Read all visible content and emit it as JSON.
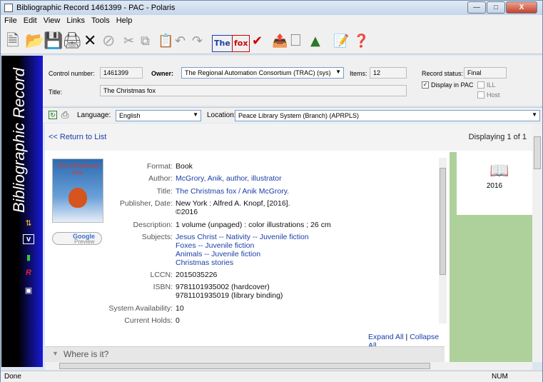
{
  "window": {
    "title": "Bibliographic Record 1461399 - PAC - Polaris"
  },
  "menu": [
    "File",
    "Edit",
    "View",
    "Links",
    "Tools",
    "Help"
  ],
  "toolbar": {
    "icons": [
      "new-icon",
      "open-icon",
      "save-icon",
      "print-icon",
      "delete-icon",
      "cancel-icon",
      "cut-icon",
      "copy-icon",
      "paste-icon",
      "undo-icon",
      "redo-icon",
      "the-icon",
      "fox-icon",
      "spell-icon",
      "export-icon",
      "template-icon",
      "link-icon",
      "properties-icon",
      "help-icon"
    ]
  },
  "sidebar": {
    "title": "Bibliographic Record"
  },
  "header": {
    "control_number_label": "Control number:",
    "control_number": "1461399",
    "owner_label": "Owner:",
    "owner": "The Regional Automation Consortium (TRAC) (sys)",
    "items_label": "Items:",
    "items": "12",
    "record_status_label": "Record status:",
    "record_status": "Final",
    "title_label": "Title:",
    "title": "The Christmas fox",
    "display_in_pac": "Display in PAC",
    "ill": "ILL",
    "host": "Host"
  },
  "bar2": {
    "language_label": "Language:",
    "language": "English",
    "location_label": "Location:",
    "location": "Peace Library System (Branch) (APRPLS)"
  },
  "content": {
    "return_link": "<< Return to List",
    "displaying": "Displaying 1 of 1",
    "year": "2016",
    "fields": {
      "format_label": "Format:",
      "format": "Book",
      "author_label": "Author:",
      "author": "McGrory, Anik, author, illustrator",
      "title_label": "Title:",
      "title": "The Christmas fox / Anik McGrory.",
      "publisher_label": "Publisher, Date:",
      "publisher": "New York : Alfred A. Knopf, [2016].",
      "publisher_date": "©2016",
      "description_label": "Description:",
      "description": "1 volume (unpaged) : color illustrations ; 26 cm",
      "subjects_label": "Subjects:",
      "subjects": [
        "Jesus Christ -- Nativity -- Juvenile fiction",
        "Foxes -- Juvenile fiction",
        "Animals -- Juvenile fiction",
        "Christmas stories"
      ],
      "lccn_label": "LCCN:",
      "lccn": "2015035226",
      "isbn_label": "ISBN:",
      "isbn1": "9781101935002 (hardcover)",
      "isbn2": "9781101935019 (library binding)",
      "availability_label": "System Availability:",
      "availability": "10",
      "holds_label": "Current Holds:",
      "holds": "0"
    },
    "expand_all": "Expand All",
    "separator": "|",
    "collapse_all": "Collapse All",
    "where_is_it": "Where is it?",
    "google_preview_1": "Google",
    "google_preview_2": "Preview",
    "cover_title": "The Christmas Fox"
  },
  "status": {
    "left": "Done",
    "num": "NUM"
  }
}
